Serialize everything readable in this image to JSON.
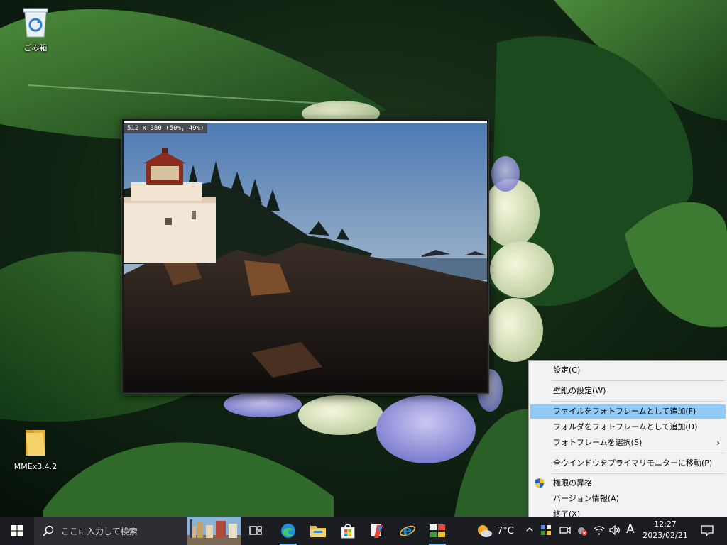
{
  "desktop": {
    "icons": [
      {
        "label": "ごみ箱",
        "icon": "recycle-bin-icon"
      },
      {
        "label": "MMEx3.4.2",
        "icon": "folder-icon"
      }
    ]
  },
  "photo_frame": {
    "info": "512 x 380 (50%, 49%)"
  },
  "context_menu": {
    "items": [
      {
        "label": "設定(C)"
      },
      {
        "label": "壁紙の設定(W)"
      },
      {
        "label": "ファイルをフォトフレームとして追加(F)",
        "highlighted": true
      },
      {
        "label": "フォルダをフォトフレームとして追加(D)"
      },
      {
        "label": "フォトフレームを選択(S)",
        "submenu": true
      },
      {
        "label": "全ウインドウをプライマリモニターに移動(P)"
      },
      {
        "label": "権限の昇格",
        "icon": "uac-shield-icon"
      },
      {
        "label": "バージョン情報(A)"
      },
      {
        "label": "終了(X)"
      }
    ],
    "highlight_color": "#91c9f7"
  },
  "taskbar": {
    "start_icon": "windows-logo-icon",
    "search_placeholder": "ここに入力して検索",
    "apps": [
      {
        "name": "task-view-icon"
      },
      {
        "name": "edge-icon"
      },
      {
        "name": "file-explorer-icon"
      },
      {
        "name": "store-icon"
      },
      {
        "name": "paint-app-icon"
      },
      {
        "name": "internet-explorer-icon"
      },
      {
        "name": "photo-frame-app-icon"
      }
    ],
    "weather_temp": "7°C",
    "ime": "A",
    "clock_time": "12:27",
    "clock_date": "2023/02/21"
  }
}
